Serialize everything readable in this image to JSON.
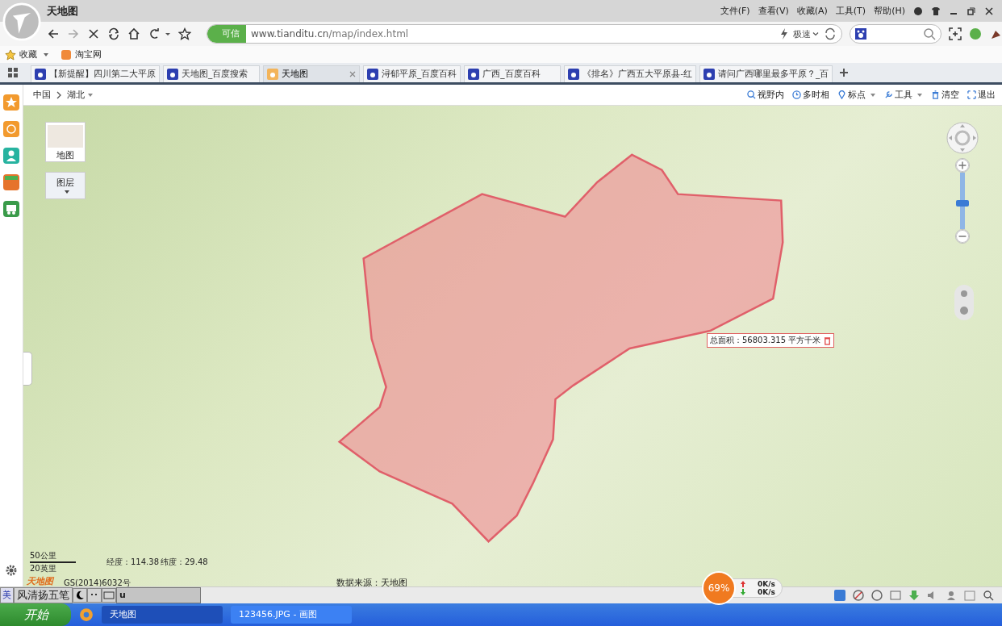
{
  "browser": {
    "title": "天地图",
    "menu": [
      "文件(F)",
      "查看(V)",
      "收藏(A)",
      "工具(T)",
      "帮助(H)"
    ],
    "address": {
      "badge": "可信",
      "domain": "www.tianditu.cn",
      "path": "/map/index.html"
    },
    "speed_mode": "极速",
    "bookmarks": [
      {
        "label": "收藏",
        "has_menu": true
      },
      {
        "label": "淘宝网",
        "has_menu": false
      }
    ],
    "tabs": [
      {
        "label": "【新提醒】四川第二大平原",
        "selected": false
      },
      {
        "label": "天地图_百度搜索",
        "selected": false
      },
      {
        "label": "天地图",
        "selected": true
      },
      {
        "label": "浔郁平原_百度百科",
        "selected": false
      },
      {
        "label": "广西_百度百科",
        "selected": false
      },
      {
        "label": "《排名》广西五大平原县-红",
        "selected": false
      },
      {
        "label": "请问广西哪里最多平原？_百",
        "selected": false
      }
    ]
  },
  "map_page": {
    "breadcrumb": [
      {
        "label": "中国",
        "has_menu": false
      },
      {
        "label": "湖北",
        "has_menu": true
      }
    ],
    "tools": [
      {
        "label": "视野内",
        "has_menu": false
      },
      {
        "label": "多时相",
        "has_menu": false
      },
      {
        "label": "标点",
        "has_menu": true
      },
      {
        "label": "工具",
        "has_menu": true
      },
      {
        "label": "清空",
        "has_menu": false
      },
      {
        "label": "退出",
        "has_menu": false
      }
    ],
    "map_type": "地图",
    "layers": "图层",
    "zoom": {
      "level": 0.45
    },
    "area_label": "总面积：56803.315 平方千米",
    "scale": [
      "50公里",
      "20英里"
    ],
    "longitude": "经度：114.38",
    "latitude": "纬度：29.48",
    "logo": "天地图",
    "approval": "GS(2014)6032号",
    "source": "数据来源：天地图"
  },
  "ime": {
    "mode": "美",
    "name": "风清扬五笔",
    "input": "u"
  },
  "net_monitor": {
    "load": "69%",
    "up": "0K/s",
    "down": "0K/s"
  },
  "taskbar": {
    "start": "开始",
    "tasks": [
      {
        "label": "天地图",
        "selected": true
      },
      {
        "label": "123456.JPG - 画图",
        "selected": false
      }
    ]
  }
}
